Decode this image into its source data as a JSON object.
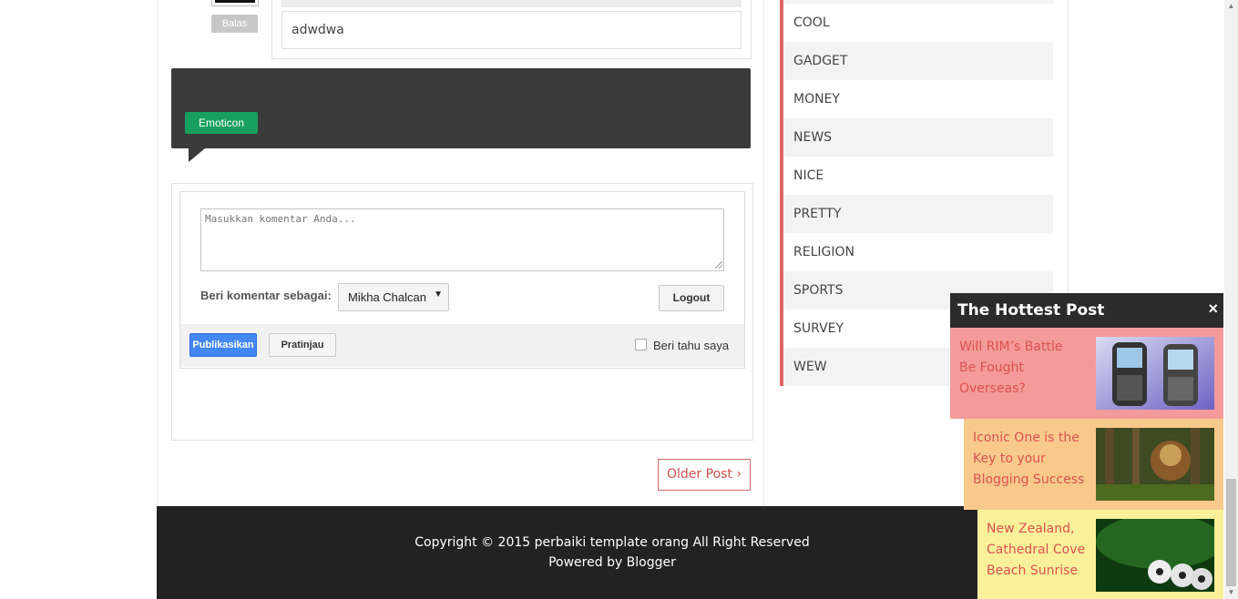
{
  "reply": {
    "reply_button": "Balas",
    "reply_text": "adwdwa"
  },
  "emoticon": {
    "button_label": "Emoticon"
  },
  "comment_form": {
    "textarea_placeholder": "Masukkan komentar Anda...",
    "comment_as_label": "Beri komentar sebagai:",
    "identity_value": "Mikha Chalcan",
    "logout_label": "Logout",
    "publish_label": "Publikasikan",
    "preview_label": "Pratinjau",
    "notify_label": "Beri tahu saya",
    "notify_checked": false
  },
  "pager": {
    "older_label": "Older Post ›"
  },
  "labels": [
    "COOL",
    "GADGET",
    "MONEY",
    "NEWS",
    "NICE",
    "PRETTY",
    "RELIGION",
    "SPORTS",
    "SURVEY",
    "WEW"
  ],
  "footer": {
    "copyright": "Copyright © 2015 perbaiki template orang All Right Reserved",
    "powered": "Powered by Blogger"
  },
  "hottest": {
    "title": "The Hottest Post",
    "close_glyph": "×",
    "items": [
      {
        "title": "Will RIM’s Battle Be Fought Overseas?",
        "bg": "#f49a9a",
        "thumb": "phones-image"
      },
      {
        "title": "Iconic One is the Key to your Blogging Success",
        "bg": "#f9c98c",
        "thumb": "forest-image"
      },
      {
        "title": "New Zealand, Cathedral Cove Beach Sunrise",
        "bg": "#fbf09a",
        "thumb": "soccer-balls-image"
      }
    ]
  },
  "colors": {
    "accent_red": "#e06666",
    "emoticon_green": "#17a05d",
    "publish_blue": "#4387f5",
    "footer_bg": "#222222"
  }
}
